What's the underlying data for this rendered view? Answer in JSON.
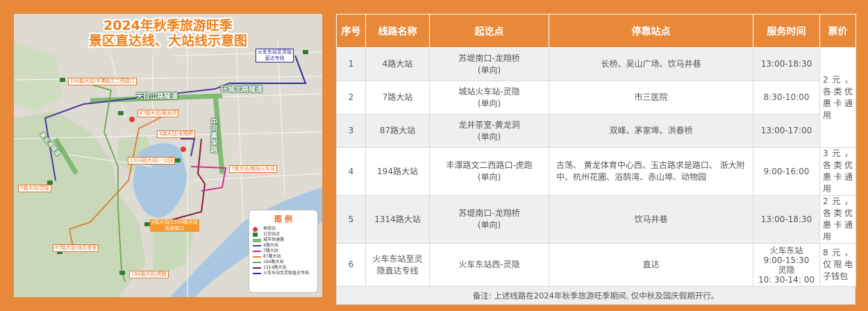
{
  "map": {
    "title_line1": "2024年秋季旅游旺季",
    "title_line2": "景区直达线、大站线示意图",
    "roads": {
      "tianmushan": "天目山路隧道",
      "huancheng": "环城北路隧道",
      "zhonghe": "中河高架路",
      "ziyun": "紫金港隧道"
    },
    "stops": {
      "huochedong": "火车东站至灵隐",
      "huochedong2": "直达专线",
      "s194_fengtan": "194路大站/丰潭路文二西路口",
      "s87_huanglong": "87路大站/黄龙洞",
      "s4_longxiang": "4路大站/龙翔桥",
      "s1314_yigongyuan": "1314路大站/一公园",
      "s7_chengzhan": "7路大站/城站火车站",
      "s7_lingyin": "7路大站/灵隐",
      "s4_sudi": "4路大站/1314路大站",
      "s4_sudi2": "苏堤南口",
      "s87_longjing": "87路大站/龙井茶室",
      "s194_hupao": "194路大站/虎跑"
    },
    "legend": {
      "title": "图  例",
      "items": [
        "地铁站",
        "公交站点",
        "城市快速路",
        "4路大站",
        "7路大站",
        "87路大站",
        "194路大站",
        "1314路大站",
        "火车东站至灵隐直达专线"
      ],
      "colors": [
        "#e53935",
        "#2e7d32",
        "#7cb96f",
        "#4a3a9a",
        "#d81b8c",
        "#e07b2a",
        "#6aa84f",
        "#8b1a3a",
        "#2b2b9e"
      ]
    }
  },
  "table": {
    "headers": [
      "序号",
      "线路名称",
      "起讫点",
      "停靠站点",
      "服务时间",
      "票价"
    ],
    "rows": [
      {
        "no": "1",
        "name": "4路大站",
        "route1": "苏堤南口-龙翔桥",
        "route2": "(单向)",
        "stops": "长桥、吴山广场、饮马井巷",
        "time": "13:00-18:30"
      },
      {
        "no": "2",
        "name": "7路大站",
        "route1": "城站火车站-灵隐",
        "route2": "(单向)",
        "stops": "市三医院",
        "time": "8:30-10:00"
      },
      {
        "no": "3",
        "name": "87路大站",
        "route1": "龙井茶室-黄龙洞",
        "route2": "(单向)",
        "stops": "双峰、茅家埠、洪春桥",
        "time": "13:00-17:00"
      },
      {
        "no": "4",
        "name": "194路大站",
        "route1": "丰潭路文二西路口-虎跑",
        "route2": "(单向)",
        "stops": "古荡、 黄龙体育中心西、玉古路求是路口、 浙大附中、杭州花圃、浴鹄湾、赤山埠、动物园",
        "time": "9:00-16:00"
      },
      {
        "no": "5",
        "name": "1314路大站",
        "route1": "苏堤南口-龙翔桥",
        "route2": "(单向)",
        "stops": "饮马井巷",
        "time": "13:00-18:30"
      },
      {
        "no": "6",
        "name": "火车东站至灵隐直达专线",
        "route1": "火车东站西-灵隐",
        "route2": "",
        "stops": "直达",
        "time_lines": [
          "火车东站",
          "9:00-15:30",
          "灵隐",
          "10: 30-14: 00"
        ]
      }
    ],
    "prices": {
      "p123": "2元，各类优惠卡通用",
      "p4": "3元，各类优惠卡通用",
      "p5": "2元，各类优惠卡通用",
      "p6": "8元，仅限电子钱包"
    },
    "note": "备注: 上述线路在2024年秋季旅游旺季期间, 仅中秋及国庆假期开行。"
  }
}
